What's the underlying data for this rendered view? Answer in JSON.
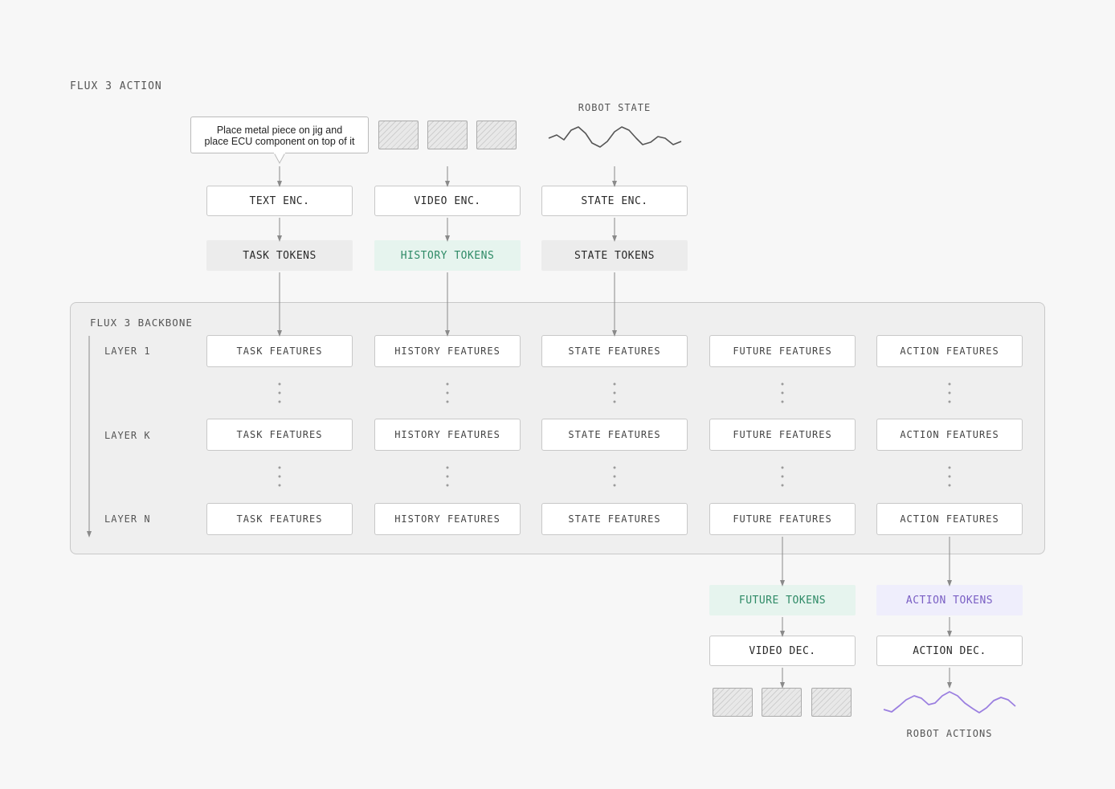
{
  "title": "FLUX 3 ACTION",
  "prompt": {
    "line1": "Place metal piece on jig and",
    "line2": "place ECU component on top of it"
  },
  "robot_state_label": "ROBOT STATE",
  "encoders": {
    "text": "TEXT ENC.",
    "video": "VIDEO ENC.",
    "state": "STATE ENC."
  },
  "tokens": {
    "task": "TASK TOKENS",
    "history": "HISTORY TOKENS",
    "state": "STATE TOKENS",
    "future": "FUTURE TOKENS",
    "action": "ACTION TOKENS"
  },
  "backbone": {
    "title": "FLUX 3 BACKBONE",
    "layers": [
      "LAYER 1",
      "LAYER K",
      "LAYER N"
    ],
    "features": [
      "TASK FEATURES",
      "HISTORY FEATURES",
      "STATE FEATURES",
      "FUTURE FEATURES",
      "ACTION FEATURES"
    ]
  },
  "decoders": {
    "video": "VIDEO DEC.",
    "action": "ACTION DEC."
  },
  "robot_actions_label": "ROBOT ACTIONS",
  "colors": {
    "history_token_bg": "#e6f4ee",
    "history_token_text": "#2e8a66",
    "action_token_bg": "#efeefc",
    "action_token_text": "#7a5fc4",
    "action_curve": "#9b7fe0",
    "neutral_token_bg": "#ececec"
  }
}
